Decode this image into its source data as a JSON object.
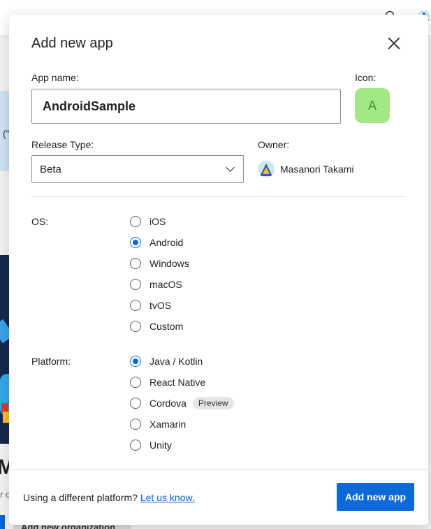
{
  "background": {
    "fragment_text": "(\"",
    "big_text": "Ma",
    "small_text": "r c",
    "secondary_button_label": "Add new organization"
  },
  "modal": {
    "title": "Add new app",
    "app_name": {
      "label": "App name:",
      "value": "AndroidSample"
    },
    "icon": {
      "label": "Icon:",
      "letter": "A",
      "color": "#a2e986"
    },
    "release_type": {
      "label": "Release Type:",
      "selected": "Beta"
    },
    "owner": {
      "label": "Owner:",
      "name": "Masanori Takami"
    },
    "os": {
      "label": "OS:",
      "options": [
        {
          "label": "iOS",
          "checked": false
        },
        {
          "label": "Android",
          "checked": true
        },
        {
          "label": "Windows",
          "checked": false
        },
        {
          "label": "macOS",
          "checked": false
        },
        {
          "label": "tvOS",
          "checked": false
        },
        {
          "label": "Custom",
          "checked": false
        }
      ]
    },
    "platform": {
      "label": "Platform:",
      "options": [
        {
          "label": "Java / Kotlin",
          "checked": true
        },
        {
          "label": "React Native",
          "checked": false
        },
        {
          "label": "Cordova",
          "checked": false,
          "badge": "Preview"
        },
        {
          "label": "Xamarin",
          "checked": false
        },
        {
          "label": "Unity",
          "checked": false
        }
      ]
    },
    "footer": {
      "prompt": "Using a different platform?",
      "link": "Let us know.",
      "submit_label": "Add new app"
    }
  },
  "colors": {
    "accent": "#0b6ad8",
    "link": "#0b63d6"
  }
}
